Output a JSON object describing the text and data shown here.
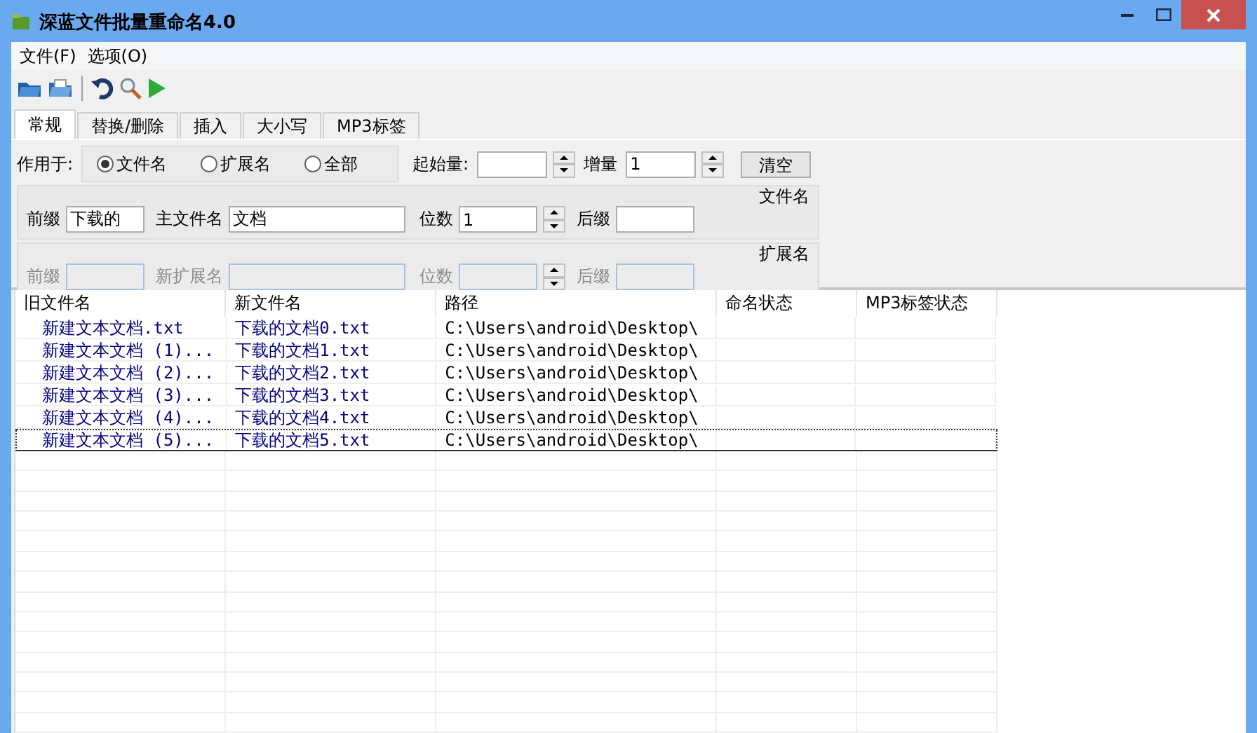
{
  "window": {
    "title": "深蓝文件批量重命名4.0"
  },
  "menu": [
    "文件(F)",
    "选项(O)"
  ],
  "tabs": [
    {
      "label": "常规",
      "selected": true
    },
    {
      "label": "替换/删除",
      "selected": false
    },
    {
      "label": "插入",
      "selected": false
    },
    {
      "label": "大小写",
      "selected": false
    },
    {
      "label": "MP3标签",
      "selected": false
    }
  ],
  "apply_to": {
    "label": "作用于:",
    "options": [
      {
        "label": "文件名",
        "selected": true
      },
      {
        "label": "扩展名",
        "selected": false
      },
      {
        "label": "全部",
        "selected": false
      }
    ]
  },
  "start": {
    "label": "起始量:"
  },
  "increment": {
    "label": "增量",
    "value": "1"
  },
  "clear_button": "清空",
  "groups": [
    {
      "title": "文件名",
      "disabled": false,
      "prefix": {
        "label": "前缀",
        "value": "下载的"
      },
      "main": {
        "label": "主文件名",
        "value": "文档"
      },
      "digits": {
        "label": "位数",
        "value": "1"
      },
      "suffix": {
        "label": "后缀"
      }
    },
    {
      "title": "扩展名",
      "disabled": true,
      "prefix": {
        "label": "前缀"
      },
      "main": {
        "label": "新扩展名"
      },
      "digits": {
        "label": "位数"
      },
      "suffix": {
        "label": "后缀"
      }
    }
  ],
  "table": {
    "columns": [
      "旧文件名",
      "新文件名",
      "路径",
      "命名状态",
      "MP3标签状态"
    ],
    "rows": [
      {
        "old": "新建文本文档.txt",
        "new": "下载的文档0.txt",
        "path": "C:\\Users\\android\\Desktop\\",
        "selected": false
      },
      {
        "old": "新建文本文档 (1)...",
        "new": "下载的文档1.txt",
        "path": "C:\\Users\\android\\Desktop\\",
        "selected": false
      },
      {
        "old": "新建文本文档 (2)...",
        "new": "下载的文档2.txt",
        "path": "C:\\Users\\android\\Desktop\\",
        "selected": false
      },
      {
        "old": "新建文本文档 (3)...",
        "new": "下载的文档3.txt",
        "path": "C:\\Users\\android\\Desktop\\",
        "selected": false
      },
      {
        "old": "新建文本文档 (4)...",
        "new": "下载的文档4.txt",
        "path": "C:\\Users\\android\\Desktop\\",
        "selected": false
      },
      {
        "old": "新建文本文档 (5)...",
        "new": "下载的文档5.txt",
        "path": "C:\\Users\\android\\Desktop\\",
        "selected": true
      }
    ]
  }
}
